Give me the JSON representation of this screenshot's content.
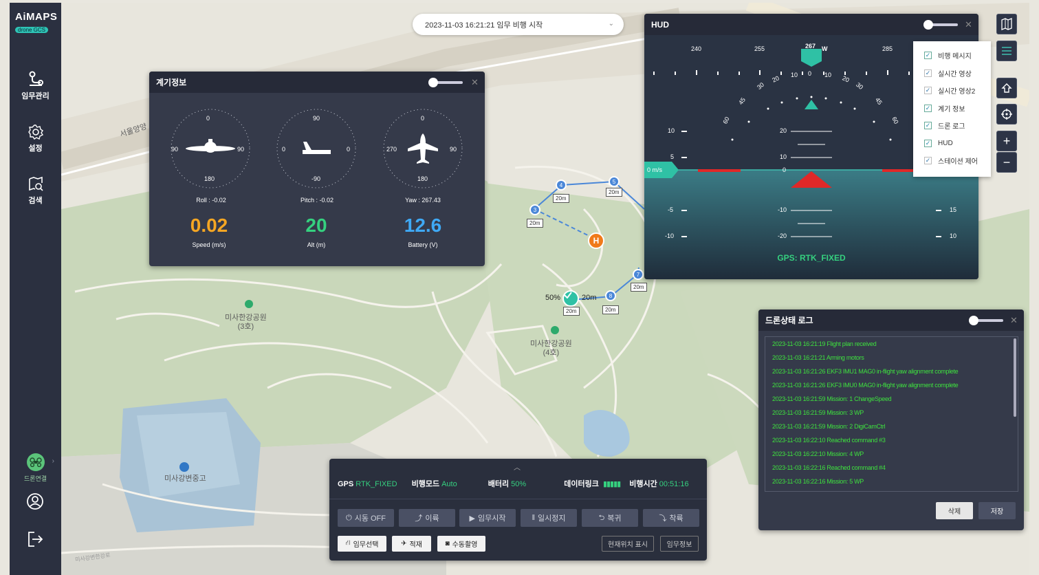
{
  "app": {
    "brand": "AiMAPS",
    "subtitle": "drone GCS"
  },
  "sidebar": {
    "items": [
      {
        "label": "임무관리",
        "icon": "route-icon"
      },
      {
        "label": "설정",
        "icon": "gear-icon"
      },
      {
        "label": "검색",
        "icon": "map-search-icon"
      }
    ],
    "drone_link_label": "드론연결"
  },
  "mission_select": {
    "value": "2023-11-03 16:21:21 임무 비행 시작"
  },
  "map": {
    "labels": {
      "park3": "미사한강공원\n(3호)",
      "park4": "미사한강공원\n(4호)",
      "school": "미사강변중고",
      "road_left": "서울양양",
      "road_bottom": "미사강변한강로"
    },
    "waypoints": [
      "3",
      "4",
      "5",
      "7",
      "8"
    ],
    "distances": [
      "20m",
      "20m",
      "20m",
      "20m",
      "20m",
      "20m",
      "20m"
    ],
    "home_label": "H",
    "drone_battery": "50%",
    "drone_dist": "20m"
  },
  "instrument_panel": {
    "title": "계기정보",
    "roll": {
      "top": "0",
      "bottom": "180",
      "left": "90",
      "right": "90",
      "label": "Roll : -0.02"
    },
    "pitch": {
      "top": "90",
      "bottom": "-90",
      "left": "0",
      "right": "0",
      "label": "Pitch : -0.02"
    },
    "yaw": {
      "top": "0",
      "bottom": "180",
      "left": "270",
      "right": "90",
      "label": "Yaw : 267.43"
    },
    "speed": {
      "value": "0.02",
      "label": "Speed (m/s)",
      "color": "#f5a623"
    },
    "alt": {
      "value": "20",
      "label": "Alt (m)",
      "color": "#35d07f"
    },
    "battery": {
      "value": "12.6",
      "label": "Battery (V)",
      "color": "#3fa9f5"
    }
  },
  "hud": {
    "title": "HUD",
    "heading_ticks": [
      "240",
      "255",
      "267",
      "285"
    ],
    "heading_dir": "W",
    "roll_marks": [
      "10",
      "0",
      "10",
      "20",
      "20",
      "30",
      "30",
      "45",
      "45",
      "60",
      "60"
    ],
    "speed_ticks": [
      "10",
      "5",
      "-5",
      "-10"
    ],
    "pitch_ticks": [
      "20",
      "10",
      "0",
      "-10",
      "-20"
    ],
    "alt_ticks": [
      "15",
      "10"
    ],
    "speed_readout": "0 m/s",
    "gps": "GPS: RTK_FIXED"
  },
  "checklist": {
    "items": [
      {
        "label": "비행 메시지",
        "checked": true
      },
      {
        "label": "실시간 영상",
        "checked": false
      },
      {
        "label": "실시간 영상2",
        "checked": false
      },
      {
        "label": "계기 정보",
        "checked": true
      },
      {
        "label": "드론 로그",
        "checked": true
      },
      {
        "label": "HUD",
        "checked": true
      },
      {
        "label": "스테이션 제어",
        "checked": false
      }
    ]
  },
  "log_panel": {
    "title": "드론상태 로그",
    "lines": [
      "2023-11-03 16:21:19 Flight plan received",
      "2023-11-03 16:21:21 Arming motors",
      "2023-11-03 16:21:26 EKF3 IMU1 MAG0 in-flight yaw alignment complete",
      "2023-11-03 16:21:26 EKF3 IMU0 MAG0 in-flight yaw alignment complete",
      "2023-11-03 16:21:59 Mission: 1 ChangeSpeed",
      "2023-11-03 16:21:59 Mission: 3 WP",
      "2023-11-03 16:21:59 Mission: 2 DigiCamCtrl",
      "2023-11-03 16:22:10 Reached command #3",
      "2023-11-03 16:22:10 Mission: 4 WP",
      "2023-11-03 16:22:16 Reached command #4",
      "2023-11-03 16:22:16 Mission: 5 WP"
    ],
    "delete_label": "삭제",
    "save_label": "저장"
  },
  "control_bar": {
    "gps_label": "GPS",
    "gps_value": "RTK_FIXED",
    "mode_label": "비행모드",
    "mode_value": "Auto",
    "battery_label": "배터리",
    "battery_value": "50%",
    "datalink_label": "데이터링크",
    "flight_time_label": "비행시간",
    "flight_time_value": "00:51:16",
    "buttons": [
      "시동 OFF",
      "이륙",
      "임무시작",
      "일시정지",
      "복귀",
      "착륙"
    ],
    "buttons2": [
      "임무선택",
      "적재",
      "수동촬영"
    ],
    "buttons3": [
      "현재위치 표시",
      "임무정보"
    ]
  }
}
